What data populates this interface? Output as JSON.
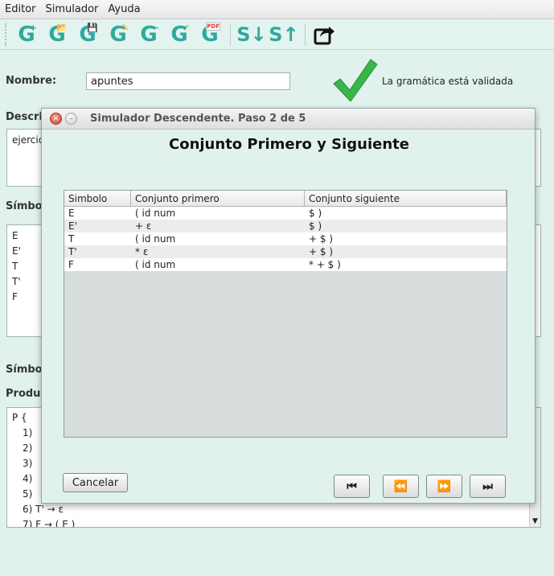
{
  "menu": [
    "Editor",
    "Simulador",
    "Ayuda"
  ],
  "toolbar": {
    "g_buttons": [
      {
        "icon": "new-grammar-icon",
        "badge": "+"
      },
      {
        "icon": "open-grammar-icon",
        "badge": "📂"
      },
      {
        "icon": "save-grammar-icon",
        "badge": "💾"
      },
      {
        "icon": "edit-grammar-icon",
        "badge": "✎"
      },
      {
        "icon": "remove-grammar-icon",
        "badge": "−"
      },
      {
        "icon": "validate-grammar-icon",
        "badge": "✓"
      },
      {
        "icon": "pdf-grammar-icon",
        "badge": "PDF"
      }
    ],
    "s_buttons": [
      "S↓",
      "S↑"
    ]
  },
  "form": {
    "nombre_label": "Nombre:",
    "nombre_value": "apuntes",
    "validated_text": "La gramática está validada",
    "descripcion_label": "Descri",
    "descripcion_value": "ejercic",
    "simbolos_label": "Símbol",
    "nonterminals": [
      "E",
      "E'",
      "T",
      "T'",
      "F"
    ],
    "simbolos2_label": "Símbol",
    "producciones_label": "Produc",
    "productions": [
      "P {",
      "1)",
      "2)",
      "3)",
      "4)",
      "5)",
      "6)   T' → ε",
      "7)   F → ( E )"
    ]
  },
  "dialog": {
    "title": "Simulador Descendente. Paso 2 de 5",
    "heading": "Conjunto Primero y Siguiente",
    "columns": [
      "Simbolo",
      "Conjunto primero",
      "Conjunto siguiente"
    ],
    "rows": [
      [
        "E",
        "( id num",
        "$ )"
      ],
      [
        "E'",
        "+ ε",
        "$ )"
      ],
      [
        "T",
        "( id num",
        "+ $ )"
      ],
      [
        "T'",
        "* ε",
        "+ $ )"
      ],
      [
        "F",
        "( id num",
        "* + $ )"
      ]
    ],
    "cancel_label": "Cancelar",
    "nav": [
      "⏮",
      "⏪",
      "⏩",
      "⏭"
    ]
  }
}
